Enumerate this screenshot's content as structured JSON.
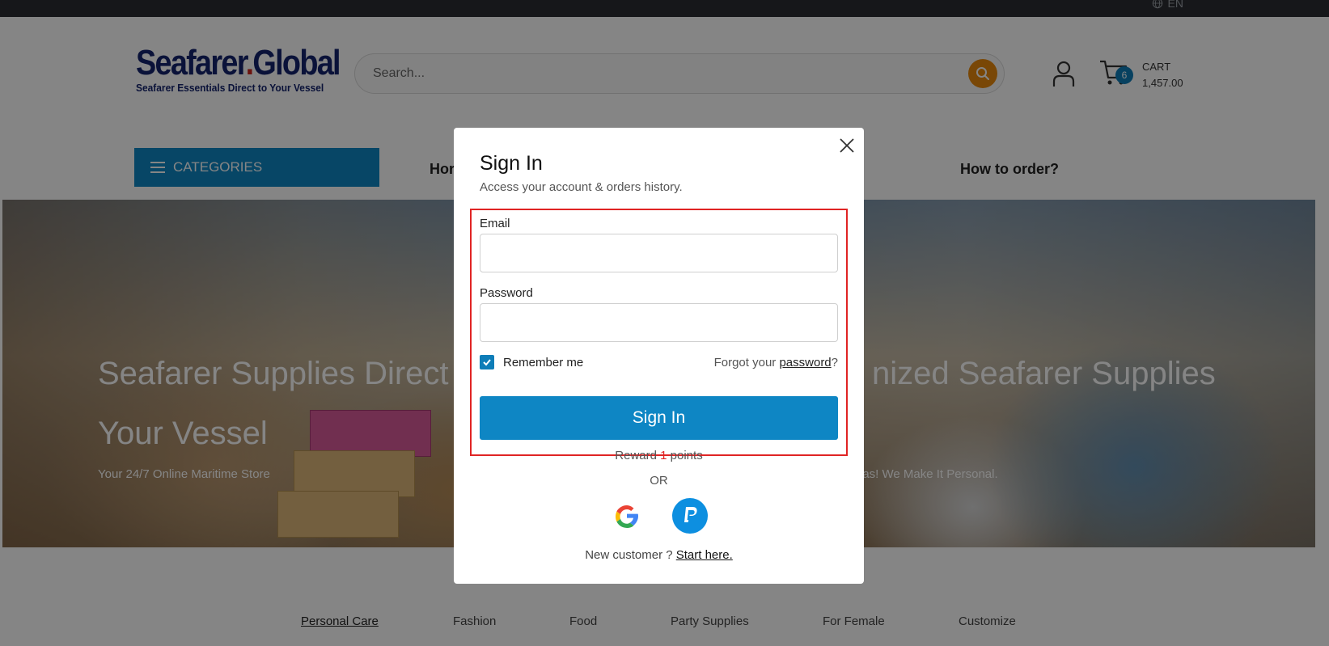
{
  "topbar": {
    "language": "EN"
  },
  "header": {
    "logo_main": "Seafarer",
    "logo_dot": ".",
    "logo_tail": "Global",
    "logo_tagline": "Seafarer Essentials Direct to Your Vessel",
    "search_placeholder": "Search...",
    "cart_label": "CART",
    "cart_total": "1,457.00",
    "cart_count": "6"
  },
  "nav": {
    "categories_label": "CATEGORIES",
    "home_partial": "Hor",
    "how_to_order": "How to order?"
  },
  "hero": {
    "title_left_line1": "Seafarer Supplies Direct",
    "title_left_line2": "Your Vessel",
    "subtitle_left": "Your 24/7 Online Maritime Store",
    "title_right": "nized Seafarer Supplies",
    "subtitle_right": "eas! We Make It Personal."
  },
  "tabs": [
    "Personal Care",
    "Fashion",
    "Food",
    "Party Supplies",
    "For Female",
    "Customize"
  ],
  "modal": {
    "title": "Sign In",
    "subtitle": "Access your account & orders history.",
    "email_label": "Email",
    "email_value": "",
    "password_label": "Password",
    "password_value": "",
    "remember_label": "Remember me",
    "remember_checked": true,
    "forgot_prefix": "Forgot your ",
    "forgot_link": "password",
    "forgot_suffix": "?",
    "signin_button": "Sign In",
    "reward_prefix": "Reward ",
    "reward_points": "1",
    "reward_suffix": " points",
    "or_label": "OR",
    "new_customer_text": "New customer ? ",
    "start_here_link": "Start here."
  },
  "colors": {
    "accent_blue": "#0e86c4",
    "search_orange": "#e8890c",
    "highlight_red": "#e02424",
    "logo_navy": "#14246e"
  }
}
